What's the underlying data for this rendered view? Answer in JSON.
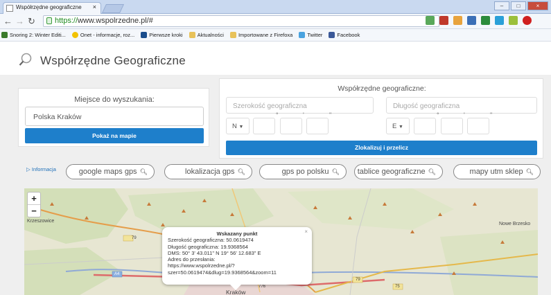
{
  "browser": {
    "tab_title": "Współrzędne geograficzne",
    "tab_close": "×",
    "url_scheme": "https://",
    "url_rest": "www.wspolrzedne.pl/#",
    "win_min": "–",
    "win_max": "□",
    "win_close": "×"
  },
  "bookmarks": [
    {
      "label": "Snoring 2: Winter Editi...",
      "color": "#3a7a2a"
    },
    {
      "label": "Onet - informacje, roz...",
      "color": "#f2c200"
    },
    {
      "label": "Pierwsze kroki",
      "color": "#1a4d8c"
    },
    {
      "label": "Aktualności",
      "color": "#e8c25a"
    },
    {
      "label": "Importowane z Firefoxa",
      "color": "#e8c25a"
    },
    {
      "label": "Twitter",
      "color": "#4aa3df"
    },
    {
      "label": "Facebook",
      "color": "#3b5998"
    }
  ],
  "site": {
    "title": "Współrzędne Geograficzne"
  },
  "search": {
    "label": "Miejsce do wyszukania:",
    "value": "Polska Kraków",
    "button": "Pokaż na mapie"
  },
  "coords": {
    "label": "Współrzędne geograficzne:",
    "lat_placeholder": "Szerokość geograficzna",
    "lon_placeholder": "Długość geograficzna",
    "lat_dir": "N",
    "lon_dir": "E",
    "deg_symbol": "°",
    "min_symbol": "'",
    "sec_symbol": "\"",
    "button": "Zlokalizuj i przelicz"
  },
  "links": {
    "info": "Informacja",
    "pills": [
      "google maps gps",
      "lokalizacja gps",
      "gps po polsku",
      "tablice geograficzne",
      "mapy utm sklep"
    ]
  },
  "map": {
    "zoom_in": "+",
    "zoom_out": "−",
    "city_left": "Krzeszowice",
    "city_right": "Nowe Brzesko",
    "city_center": "Kraków",
    "road_79": "79",
    "road_a4": "A4",
    "road_75": "75",
    "road_776": "776"
  },
  "popup": {
    "title": "Wskazany punkt",
    "close": "×",
    "lines": [
      "Szerokość geograficzna: 50.0619474",
      "Długość geograficzna: 19.9368564",
      "DMS: 50° 3' 43.011\" N 19° 56' 12.683\" E",
      "Adres do przesłania:",
      "https://www.wspolrzedne.pl/?",
      "szer=50.0619474&dlug=19.9368564&zoom=11"
    ]
  }
}
